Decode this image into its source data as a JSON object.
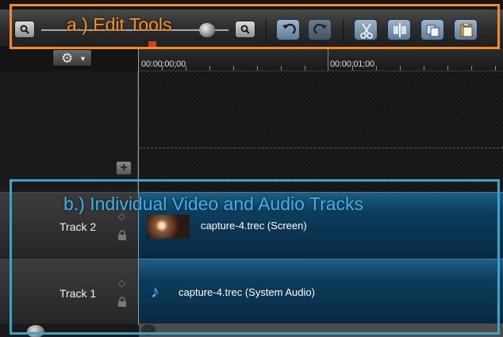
{
  "toolbar": {
    "zoom_out_icon": "zoom-out-icon",
    "zoom_in_icon": "zoom-in-icon",
    "buttons": [
      {
        "name": "undo",
        "icon": "undo-icon"
      },
      {
        "name": "redo",
        "icon": "redo-icon"
      },
      {
        "name": "cut",
        "icon": "scissors-icon"
      },
      {
        "name": "split",
        "icon": "split-icon"
      },
      {
        "name": "copy",
        "icon": "copy-icon"
      },
      {
        "name": "paste",
        "icon": "paste-icon"
      }
    ]
  },
  "timeline": {
    "settings_icon": "gear-icon",
    "timecodes": [
      "00:00:00;00",
      "00:00:01;00"
    ],
    "add_track_label": "+"
  },
  "tracks": [
    {
      "name": "Track 2",
      "clip_label": "capture-4.trec (Screen)",
      "clip_icon": "video-thumbnail"
    },
    {
      "name": "Track 1",
      "clip_label": "capture-4.trec (System Audio)",
      "clip_icon": "music-note-icon"
    }
  ],
  "annotations": {
    "a": "a.)  Edit Tools",
    "b": "b.)  Individual Video and Audio Tracks"
  },
  "colors": {
    "annotation_a": "#f58a2a",
    "annotation_b": "#3aa4c8",
    "track_fill": "#0d3d5c",
    "playhead": "#d43b27"
  }
}
